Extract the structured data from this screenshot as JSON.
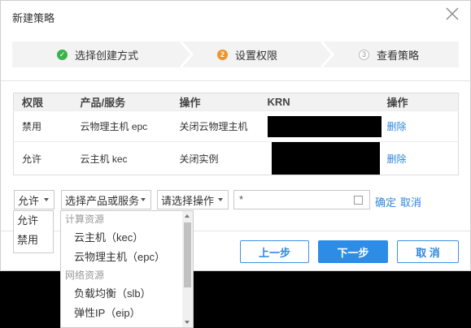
{
  "dialog": {
    "title": "新建策略"
  },
  "steps": [
    {
      "label": "选择创建方式",
      "marker": "✓",
      "state": "done"
    },
    {
      "label": "设置权限",
      "marker": "2",
      "state": "current"
    },
    {
      "label": "查看策略",
      "marker": "3",
      "state": "pending"
    }
  ],
  "table": {
    "headers": [
      "权限",
      "产品/服务",
      "操作",
      "KRN",
      "操作"
    ],
    "rows": [
      {
        "permission": "禁用",
        "product": "云物理主机 epc",
        "action": "关闭云物理主机",
        "krn": "",
        "delete": "删除"
      },
      {
        "permission": "允许",
        "product": "云主机 kec",
        "action": "关闭实例",
        "krn": "",
        "delete": "删除"
      }
    ]
  },
  "form": {
    "permission_select": "允许",
    "product_select": "选择产品或服务",
    "action_select": "请选择操作",
    "resource_input": "*",
    "confirm": "确定",
    "cancel": "取消"
  },
  "permission_dropdown": [
    "允许",
    "禁用"
  ],
  "product_dropdown": {
    "group1": "计算资源",
    "group1_items": [
      "云主机（kec）",
      "云物理主机（epc）"
    ],
    "group2": "网络资源",
    "group2_items": [
      "负载均衡（slb）",
      "弹性IP（eip）"
    ]
  },
  "footer": {
    "prev": "上一步",
    "next": "下一步",
    "cancel": "取 消"
  },
  "colors": {
    "accent": "#2d8ce6",
    "success": "#3bb34a",
    "current_step": "#f0932b"
  }
}
